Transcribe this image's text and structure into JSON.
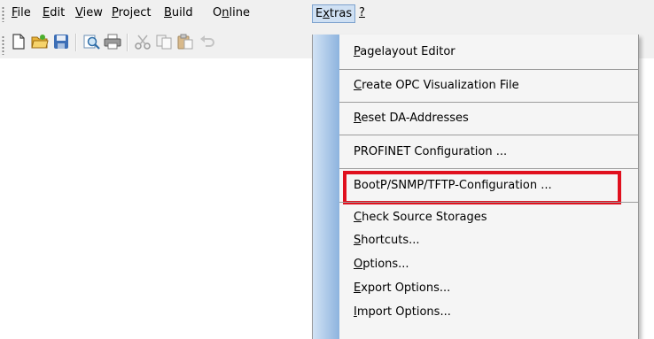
{
  "menubar": {
    "items": [
      {
        "pre": "",
        "key": "F",
        "post": "ile"
      },
      {
        "pre": "",
        "key": "E",
        "post": "dit"
      },
      {
        "pre": "",
        "key": "V",
        "post": "iew"
      },
      {
        "pre": "",
        "key": "P",
        "post": "roject"
      },
      {
        "pre": "",
        "key": "B",
        "post": "uild"
      },
      {
        "pre": "O",
        "key": "n",
        "post": "line"
      },
      {
        "pre": "E",
        "key": "x",
        "post": "tras"
      },
      {
        "pre": "",
        "key": "?",
        "post": ""
      }
    ],
    "active_index": 6
  },
  "toolbar": {
    "icons": [
      "new-file-icon",
      "open-folder-icon",
      "save-icon",
      "print-preview-icon",
      "print-icon",
      "cut-icon",
      "copy-icon",
      "paste-icon",
      "undo-icon"
    ]
  },
  "dropdown": {
    "items": [
      {
        "pre": "",
        "key": "P",
        "post": "agelayout Editor"
      },
      {
        "pre": "",
        "key": "C",
        "post": "reate OPC Visualization File"
      },
      {
        "pre": "",
        "key": "R",
        "post": "eset DA-Addresses"
      },
      {
        "pre": "PROFINET Configuration ...",
        "key": "",
        "post": ""
      },
      {
        "pre": "BootP/SNMP/TFTP-Configuration ...",
        "key": "",
        "post": ""
      },
      {
        "pre": "",
        "key": "C",
        "post": "heck Source Storages"
      },
      {
        "pre": "",
        "key": "S",
        "post": "hortcuts..."
      },
      {
        "pre": "",
        "key": "O",
        "post": "ptions..."
      },
      {
        "pre": "",
        "key": "E",
        "post": "xport Options..."
      },
      {
        "pre": "",
        "key": "I",
        "post": "mport Options..."
      }
    ],
    "highlighted_index": 4,
    "highlight_color": "#e0101e"
  },
  "colors": {
    "menu_active_bg": "#cfe0f3",
    "menu_active_border": "#7da2ce",
    "stripe_light": "#d2e3f5",
    "stripe_dark": "#8db3de"
  }
}
